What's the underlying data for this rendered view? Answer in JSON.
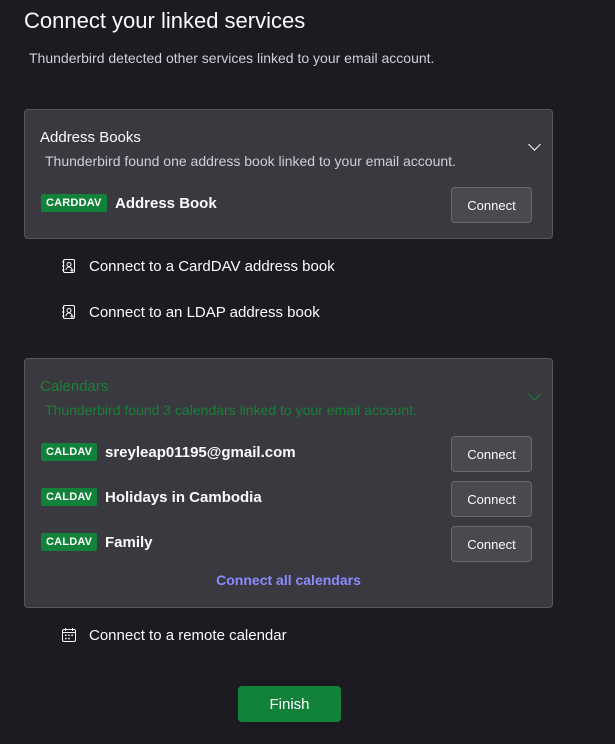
{
  "header": {
    "title": "Connect your linked services",
    "subtitle": "Thunderbird detected other services linked to your email account."
  },
  "address_books": {
    "title": "Address Books",
    "description": "Thunderbird found one address book linked to your email account.",
    "items": [
      {
        "type": "CARDDAV",
        "name": "Address Book",
        "button": "Connect"
      }
    ]
  },
  "address_links": [
    {
      "label": "Connect to a CardDAV address book",
      "icon": "address-book-icon"
    },
    {
      "label": "Connect to an LDAP address book",
      "icon": "address-book-icon"
    }
  ],
  "calendars": {
    "title": "Calendars",
    "description": "Thunderbird found 3 calendars linked to your email account.",
    "items": [
      {
        "type": "CALDAV",
        "name": "sreyleap01195@gmail.com",
        "button": "Connect"
      },
      {
        "type": "CALDAV",
        "name": "Holidays in Cambodia",
        "button": "Connect"
      },
      {
        "type": "CALDAV",
        "name": "Family",
        "button": "Connect"
      }
    ],
    "connect_all": "Connect all calendars"
  },
  "calendar_link": {
    "label": "Connect to a remote calendar",
    "icon": "calendar-icon"
  },
  "footer": {
    "finish": "Finish"
  },
  "colors": {
    "background": "#1c1b22",
    "card": "#3a3940",
    "accent_green": "#12813a",
    "link": "#8b8bff"
  }
}
